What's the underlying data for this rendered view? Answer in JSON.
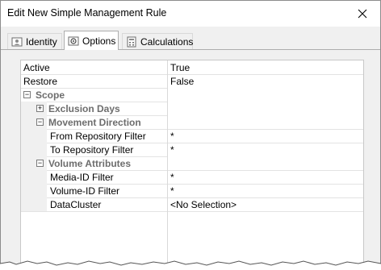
{
  "window": {
    "title": "Edit New Simple Management Rule"
  },
  "tabs": [
    {
      "label": "Identity",
      "icon": "identity-icon"
    },
    {
      "label": "Options",
      "icon": "options-icon"
    },
    {
      "label": "Calculations",
      "icon": "calculations-icon"
    }
  ],
  "properties": {
    "active": {
      "name": "Active",
      "value": "True"
    },
    "restore": {
      "name": "Restore",
      "value": "False"
    },
    "scope": {
      "name": "Scope"
    },
    "exclusion_days": {
      "name": "Exclusion Days"
    },
    "movement_direction": {
      "name": "Movement Direction"
    },
    "from_repo": {
      "name": "From Repository Filter",
      "value": "*"
    },
    "to_repo": {
      "name": "To Repository Filter",
      "value": "*"
    },
    "volume_attributes": {
      "name": "Volume Attributes"
    },
    "media_id": {
      "name": "Media-ID Filter",
      "value": "*"
    },
    "volume_id": {
      "name": "Volume-ID Filter",
      "value": "*"
    },
    "datacluster": {
      "name": "DataCluster",
      "value": "<No Selection>"
    }
  },
  "expander": {
    "collapse": "−",
    "expand": "+"
  }
}
